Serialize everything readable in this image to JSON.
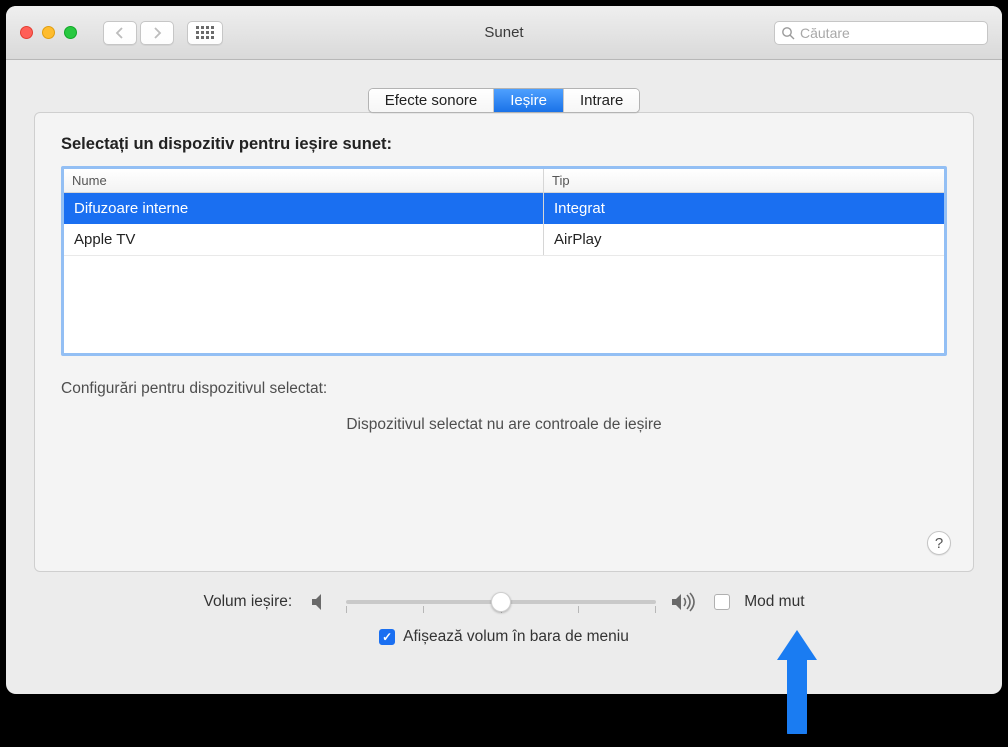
{
  "window": {
    "title": "Sunet"
  },
  "search": {
    "placeholder": "Căutare"
  },
  "tabs": {
    "effects": "Efecte sonore",
    "output": "Ieșire",
    "input": "Intrare",
    "activeIndex": 1
  },
  "panel": {
    "title": "Selectați un dispozitiv pentru ieșire sunet:",
    "columns": {
      "name": "Nume",
      "type": "Tip"
    },
    "devices": [
      {
        "name": "Difuzoare interne",
        "type": "Integrat",
        "selected": true
      },
      {
        "name": "Apple TV",
        "type": "AirPlay",
        "selected": false
      }
    ],
    "settingsFor": "Configurări pentru dispozitivul selectat:",
    "noControls": "Dispozitivul selectat nu are controale de ieșire"
  },
  "volume": {
    "label": "Volum ieșire:",
    "muteLabel": "Mod mut",
    "muted": false,
    "percent": 50,
    "showInMenuLabel": "Afișează volum în bara de meniu",
    "showInMenu": true
  },
  "help": {
    "symbol": "?"
  },
  "colors": {
    "accent": "#1a6ff1",
    "arrow": "#1a7cf2"
  }
}
